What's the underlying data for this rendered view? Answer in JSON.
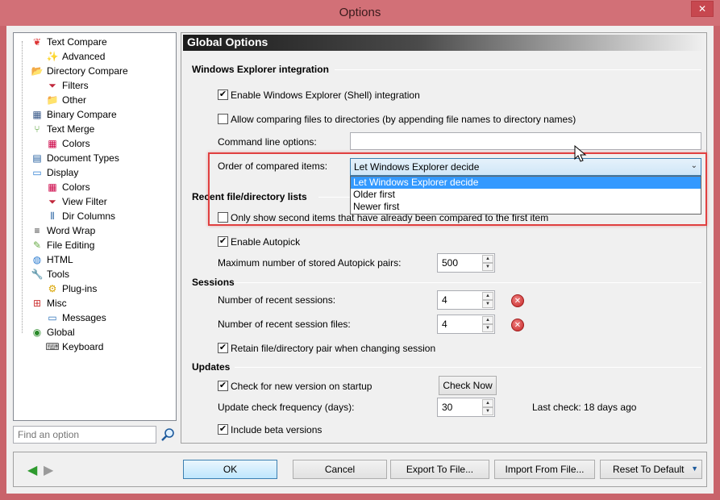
{
  "window": {
    "title": "Options"
  },
  "tree": [
    {
      "label": "Text Compare",
      "icon": "text-compare-icon",
      "level": 0
    },
    {
      "label": "Advanced",
      "icon": "wand-icon",
      "level": 1
    },
    {
      "label": "Directory Compare",
      "icon": "folder-compare-icon",
      "level": 0
    },
    {
      "label": "Filters",
      "icon": "filter-icon",
      "level": 1
    },
    {
      "label": "Other",
      "icon": "folder-icon",
      "level": 1
    },
    {
      "label": "Binary Compare",
      "icon": "binary-icon",
      "level": 0
    },
    {
      "label": "Text Merge",
      "icon": "merge-icon",
      "level": 0
    },
    {
      "label": "Colors",
      "icon": "colors-icon",
      "level": 1
    },
    {
      "label": "Document Types",
      "icon": "document-types-icon",
      "level": 0
    },
    {
      "label": "Display",
      "icon": "monitor-icon",
      "level": 0
    },
    {
      "label": "Colors",
      "icon": "colors-icon",
      "level": 1
    },
    {
      "label": "View Filter",
      "icon": "filter-icon",
      "level": 1
    },
    {
      "label": "Dir Columns",
      "icon": "columns-icon",
      "level": 1
    },
    {
      "label": "Word Wrap",
      "icon": "word-wrap-icon",
      "level": 0
    },
    {
      "label": "File Editing",
      "icon": "edit-icon",
      "level": 0
    },
    {
      "label": "HTML",
      "icon": "html-icon",
      "level": 0
    },
    {
      "label": "Tools",
      "icon": "wrench-icon",
      "level": 0
    },
    {
      "label": "Plug-ins",
      "icon": "gear-icon",
      "level": 1
    },
    {
      "label": "Misc",
      "icon": "misc-icon",
      "level": 0
    },
    {
      "label": "Messages",
      "icon": "message-icon",
      "level": 1
    },
    {
      "label": "Global",
      "icon": "globe-icon",
      "level": 0
    },
    {
      "label": "Keyboard",
      "icon": "keyboard-icon",
      "level": 1
    }
  ],
  "find": {
    "placeholder": "Find an option"
  },
  "panel": {
    "header": "Global Options",
    "explorer": {
      "title": "Windows Explorer integration",
      "enable_shell": "Enable Windows Explorer (Shell) integration",
      "allow_dirs": "Allow comparing files to directories (by appending file names to directory names)",
      "cmdline_label": "Command line options:",
      "cmdline_value": "",
      "order_label": "Order of compared items:",
      "order_value": "Let Windows Explorer decide",
      "order_options": [
        "Let Windows Explorer decide",
        "Older first",
        "Newer first"
      ]
    },
    "recent": {
      "title": "Recent file/directory lists",
      "only_show": "Only show second items that have already been compared to the first item",
      "autopick": "Enable Autopick",
      "max_pairs_label": "Maximum number of stored Autopick pairs:",
      "max_pairs_value": "500"
    },
    "sessions": {
      "title": "Sessions",
      "recent_sessions_label": "Number of recent sessions:",
      "recent_sessions_value": "4",
      "recent_files_label": "Number of recent session files:",
      "recent_files_value": "4",
      "retain": "Retain file/directory pair when changing session"
    },
    "updates": {
      "title": "Updates",
      "check_startup": "Check for new version on startup",
      "check_now": "Check Now",
      "freq_label": "Update check frequency (days):",
      "freq_value": "30",
      "last_check": "Last check: 18 days ago",
      "beta": "Include beta versions"
    }
  },
  "buttons": {
    "ok": "OK",
    "cancel": "Cancel",
    "export": "Export To File...",
    "import": "Import From File...",
    "reset": "Reset To Default"
  },
  "colors": {
    "accent": "#3399ff",
    "highlight_border": "#e04040",
    "title_bar": "#d27077"
  }
}
